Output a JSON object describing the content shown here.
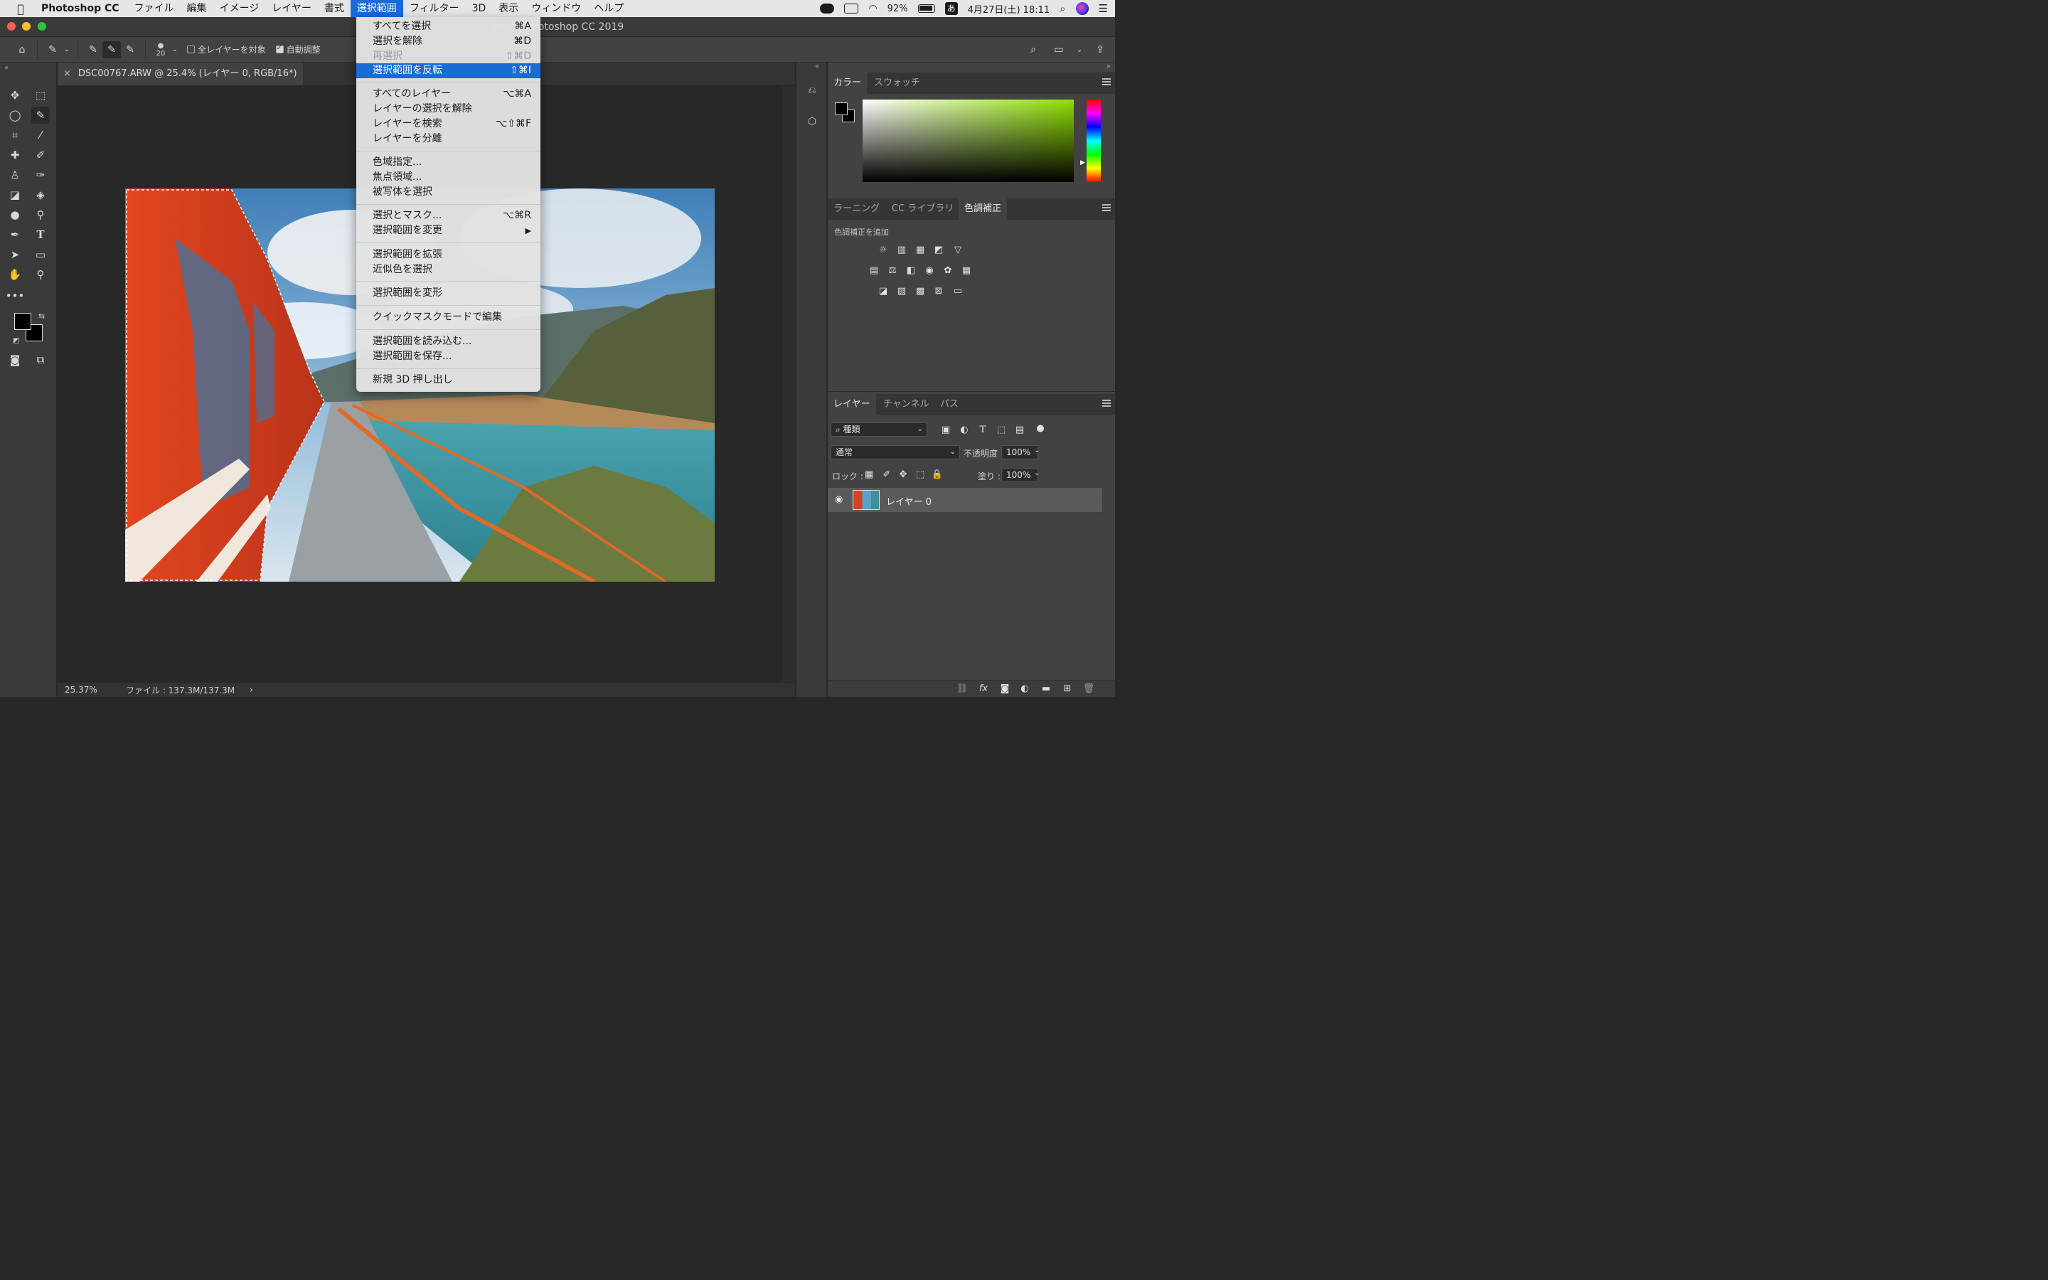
{
  "menubar": {
    "app": "Photoshop CC",
    "items": [
      "ファイル",
      "編集",
      "イメージ",
      "レイヤー",
      "書式",
      "選択範囲",
      "フィルター",
      "3D",
      "表示",
      "ウィンドウ",
      "ヘルプ"
    ],
    "battery": "92%",
    "ime": "あ",
    "clock": "4月27日(土)  18:11"
  },
  "window": {
    "title": "Adobe Photoshop CC 2019"
  },
  "options": {
    "brush_size": "20",
    "sample_all_layers": "全レイヤーを対象",
    "auto_enhance": "自動調整"
  },
  "document": {
    "tab_title": "DSC00767.ARW @ 25.4% (レイヤー 0, RGB/16*) *",
    "close_glyph": "×"
  },
  "status": {
    "zoom": "25.37%",
    "file_info": "ファイル : 137.3M/137.3M",
    "arrow": "›"
  },
  "select_menu": {
    "items": [
      {
        "label": "すべてを選択",
        "shortcut": "⌘A"
      },
      {
        "label": "選択を解除",
        "shortcut": "⌘D"
      },
      {
        "label": "再選択",
        "shortcut": "⇧⌘D",
        "disabled": true
      },
      {
        "label": "選択範囲を反転",
        "shortcut": "⇧⌘I",
        "highlighted": true
      },
      {
        "label": "すべてのレイヤー",
        "shortcut": "⌥⌘A"
      },
      {
        "label": "レイヤーの選択を解除",
        "shortcut": ""
      },
      {
        "label": "レイヤーを検索",
        "shortcut": "⌥⇧⌘F"
      },
      {
        "label": "レイヤーを分離",
        "shortcut": ""
      },
      {
        "label": "色域指定...",
        "shortcut": ""
      },
      {
        "label": "焦点領域...",
        "shortcut": ""
      },
      {
        "label": "被写体を選択",
        "shortcut": ""
      },
      {
        "label": "選択とマスク...",
        "shortcut": "⌥⌘R"
      },
      {
        "label": "選択範囲を変更",
        "shortcut": "▶"
      },
      {
        "label": "選択範囲を拡張",
        "shortcut": ""
      },
      {
        "label": "近似色を選択",
        "shortcut": ""
      },
      {
        "label": "選択範囲を変形",
        "shortcut": ""
      },
      {
        "label": "クイックマスクモードで編集",
        "shortcut": ""
      },
      {
        "label": "選択範囲を読み込む...",
        "shortcut": ""
      },
      {
        "label": "選択範囲を保存...",
        "shortcut": ""
      },
      {
        "label": "新規 3D 押し出し",
        "shortcut": ""
      }
    ]
  },
  "color_panel": {
    "tabs": [
      "カラー",
      "スウォッチ"
    ]
  },
  "adjust_panel": {
    "tabs": [
      "ラーニング",
      "CC ライブラリ",
      "色調補正"
    ],
    "add_label": "色調補正を追加"
  },
  "layers_panel": {
    "tabs": [
      "レイヤー",
      "チャンネル",
      "パス"
    ],
    "filter_kind": "種類",
    "blend_mode": "通常",
    "opacity_label": "不透明度 :",
    "opacity_value": "100%",
    "lock_label": "ロック :",
    "fill_label": "塗り :",
    "fill_value": "100%",
    "layer_name": "レイヤー 0"
  },
  "colors": {
    "accent": "#1a6ad8",
    "train_red": "#d8421c"
  }
}
